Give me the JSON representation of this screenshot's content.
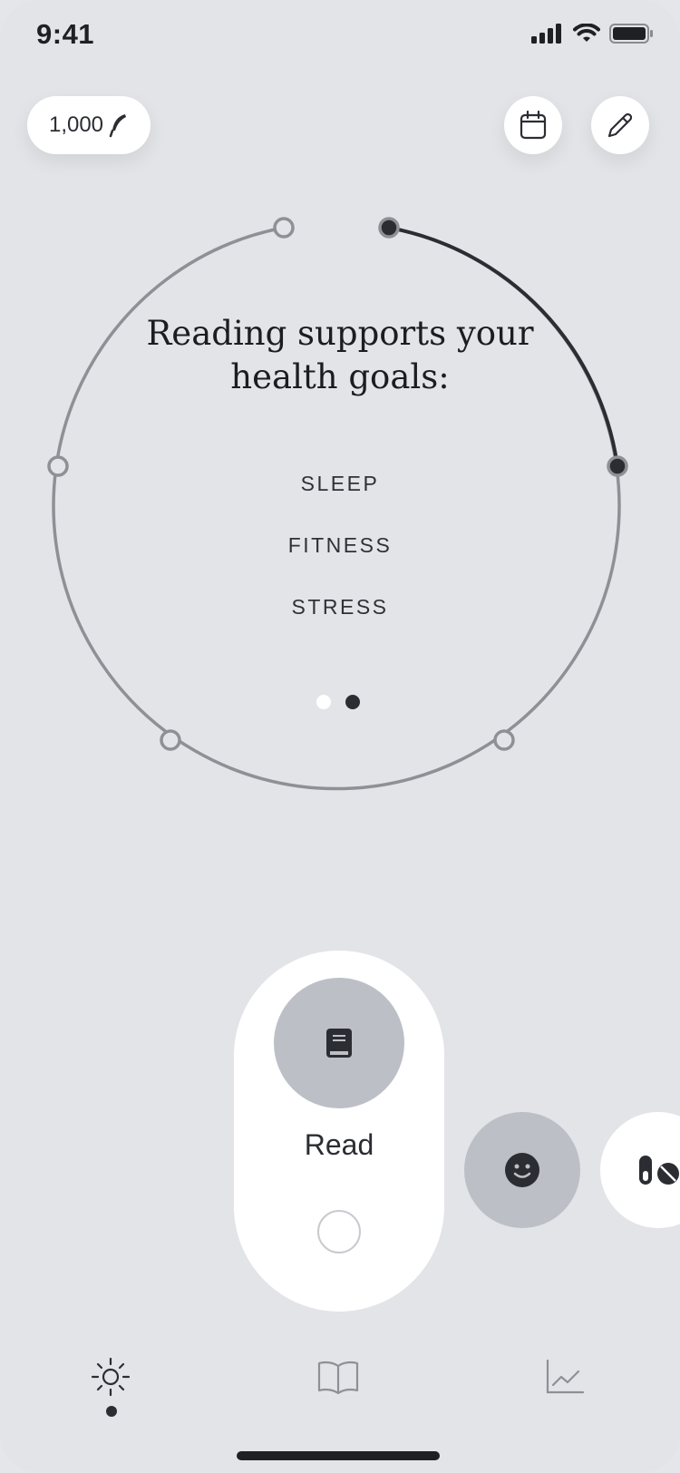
{
  "status_bar": {
    "time": "9:41",
    "icons": [
      "signal-icon",
      "wifi-icon",
      "battery-icon"
    ]
  },
  "header": {
    "coins": "1,000",
    "coins_icon": "feather-icon",
    "calendar_icon": "calendar-icon",
    "edit_icon": "pencil-icon"
  },
  "ring": {
    "title": "Reading supports your health goals:",
    "goals": [
      "SLEEP",
      "FITNESS",
      "STRESS"
    ],
    "pages": 2,
    "current_page": 2
  },
  "activities": {
    "read": {
      "label": "Read",
      "icon": "book-icon",
      "checked": false
    },
    "mood": {
      "icon": "smiley-icon"
    },
    "meds": {
      "icon": "pill-icon"
    }
  },
  "tab_bar": {
    "tabs": [
      {
        "icon": "sun-icon",
        "active": true
      },
      {
        "icon": "open-book-icon",
        "active": false
      },
      {
        "icon": "chart-icon",
        "active": false
      }
    ]
  },
  "colors": {
    "background": "#e3e4e8",
    "ring_track": "#8f9095",
    "ring_progress": "#2b2d33",
    "card": "#ffffff",
    "icon_circle": "#bcc0c6"
  }
}
